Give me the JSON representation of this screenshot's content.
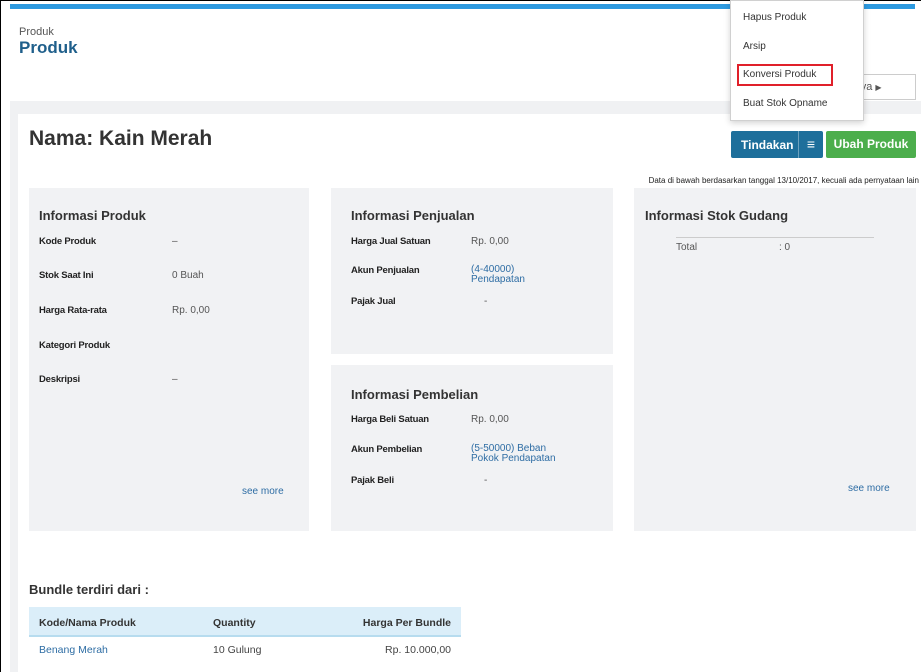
{
  "header": {
    "breadcrumb": "Produk",
    "title": "Produk",
    "next_label": "jutnya"
  },
  "product": {
    "name_title": "Nama: Kain Merah"
  },
  "actions": {
    "tindakan_label": "Tindakan",
    "ubah_label": "Ubah Produk",
    "menu_icon": "hamburger-icon"
  },
  "dropdown": {
    "items": [
      "Hapus Produk",
      "Arsip",
      "Konversi Produk",
      "Buat Stok Opname"
    ]
  },
  "data_note": "Data di bawah berdasarkan tanggal 13/10/2017, kecuali ada pernyataan lain",
  "info_produk": {
    "title": "Informasi Produk",
    "rows": [
      {
        "label": "Kode Produk",
        "value": "–"
      },
      {
        "label": "Stok Saat Ini",
        "value": "0 Buah"
      },
      {
        "label": "Harga Rata-rata",
        "value": "Rp. 0,00"
      },
      {
        "label": "Kategori Produk",
        "value": ""
      },
      {
        "label": "Deskripsi",
        "value": "–"
      }
    ],
    "see_more": "see more"
  },
  "info_penjualan": {
    "title": "Informasi Penjualan",
    "rows": [
      {
        "label": "Harga Jual Satuan",
        "value": "Rp. 0,00"
      },
      {
        "label": "Akun Penjualan",
        "value_line1": "(4-40000)",
        "value_line2": "Pendapatan"
      },
      {
        "label": "Pajak Jual",
        "value": "-"
      }
    ]
  },
  "info_pembelian": {
    "title": "Informasi Pembelian",
    "rows": [
      {
        "label": "Harga Beli Satuan",
        "value": "Rp. 0,00"
      },
      {
        "label": "Akun Pembelian",
        "value_line1": "(5-50000) Beban",
        "value_line2": "Pokok Pendapatan"
      },
      {
        "label": "Pajak Beli",
        "value": "-"
      }
    ]
  },
  "info_stok": {
    "title": "Informasi Stok Gudang",
    "total_label": "Total",
    "total_value": ": 0",
    "see_more": "see more"
  },
  "bundle": {
    "title": "Bundle terdiri dari :",
    "columns": [
      "Kode/Nama Produk",
      "Quantity",
      "Harga Per Bundle"
    ],
    "rows": [
      {
        "product": "Benang Merah",
        "quantity": "10 Gulung",
        "price": "Rp. 10.000,00"
      }
    ]
  },
  "colors": {
    "accent_blue": "#2d9ae0",
    "tindakan_bg": "#1e6f9b",
    "ubah_bg": "#4cae4c",
    "link": "#2e6da4",
    "highlight_red": "#e0202a"
  }
}
